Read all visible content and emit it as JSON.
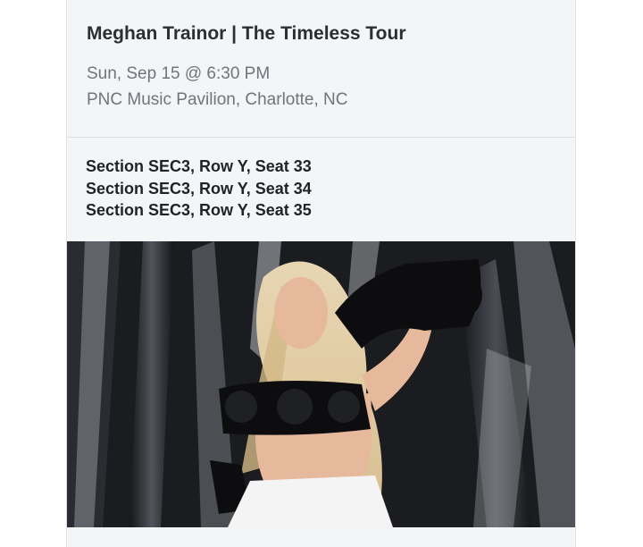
{
  "event": {
    "title": "Meghan Trainor | The Timeless Tour",
    "datetime": "Sun, Sep 15 @ 6:30 PM",
    "venue": "PNC Music Pavilion, Charlotte, NC"
  },
  "seats": [
    "Section SEC3, Row Y, Seat 33",
    "Section SEC3, Row Y, Seat 34",
    "Section SEC3, Row Y, Seat 35"
  ],
  "hero_image": {
    "icon": "artist-photo",
    "colors": {
      "background": "#1b1c1f",
      "foil_highlight": "#d9dde3",
      "hair": "#e6d3ae",
      "skin": "#e7b99c",
      "black_outfit": "#0d0d0f",
      "white_skirt": "#f4f4f4"
    }
  }
}
